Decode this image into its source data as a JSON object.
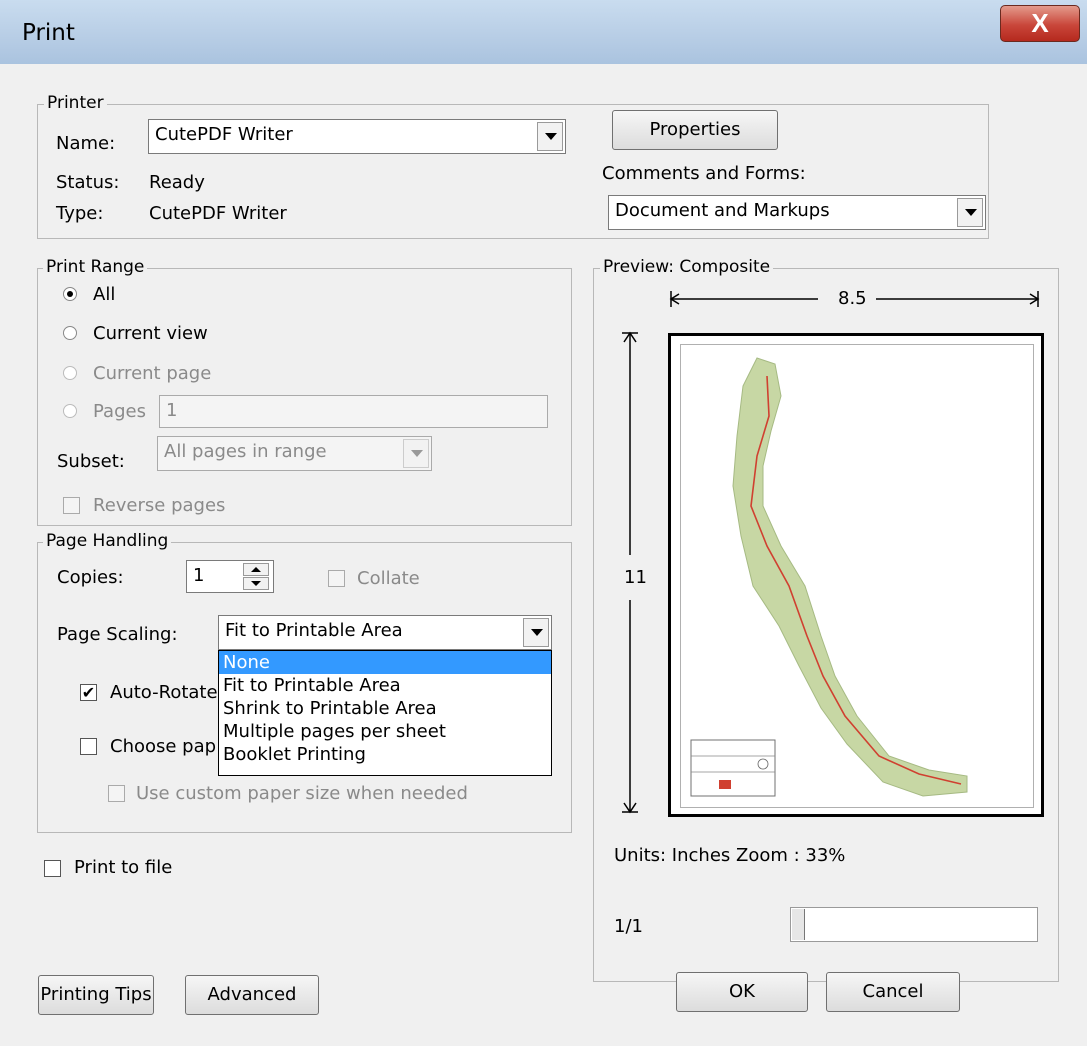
{
  "window": {
    "title": "Print",
    "close_glyph": "X"
  },
  "printer": {
    "legend": "Printer",
    "name_label": "Name:",
    "name_value": "CutePDF Writer",
    "status_label": "Status:",
    "status_value": "Ready",
    "type_label": "Type:",
    "type_value": "CutePDF Writer",
    "properties_button": "Properties",
    "comments_label": "Comments and Forms:",
    "comments_value": "Document and Markups"
  },
  "print_range": {
    "legend": "Print Range",
    "all": "All",
    "current_view": "Current view",
    "current_page": "Current page",
    "pages_label": "Pages",
    "pages_value": "1",
    "subset_label": "Subset:",
    "subset_value": "All pages in range",
    "reverse_pages": "Reverse pages",
    "selected": "All"
  },
  "page_handling": {
    "legend": "Page Handling",
    "copies_label": "Copies:",
    "copies_value": "1",
    "collate_label": "Collate",
    "scaling_label": "Page Scaling:",
    "scaling_value": "Fit to Printable Area",
    "scaling_options": [
      "None",
      "Fit to Printable Area",
      "Shrink to Printable Area",
      "Multiple pages per sheet",
      "Booklet Printing"
    ],
    "highlighted_option": "None",
    "auto_rotate_label": "Auto-Rotate",
    "auto_rotate_checked": true,
    "choose_paper_label": "Choose pap",
    "custom_paper_label": "Use custom paper size when needed"
  },
  "print_to_file": "Print to file",
  "preview": {
    "legend": "Preview: Composite",
    "width_label": "8.5",
    "height_label": "11",
    "units_zoom": "Units: Inches Zoom :  33%",
    "page_counter": "1/1"
  },
  "buttons": {
    "printing_tips": "Printing Tips",
    "advanced": "Advanced",
    "ok": "OK",
    "cancel": "Cancel"
  },
  "colors": {
    "highlight": "#3399ff",
    "route": "#d04030",
    "titlebar": "#b7cde5",
    "close": "#c9463a"
  }
}
